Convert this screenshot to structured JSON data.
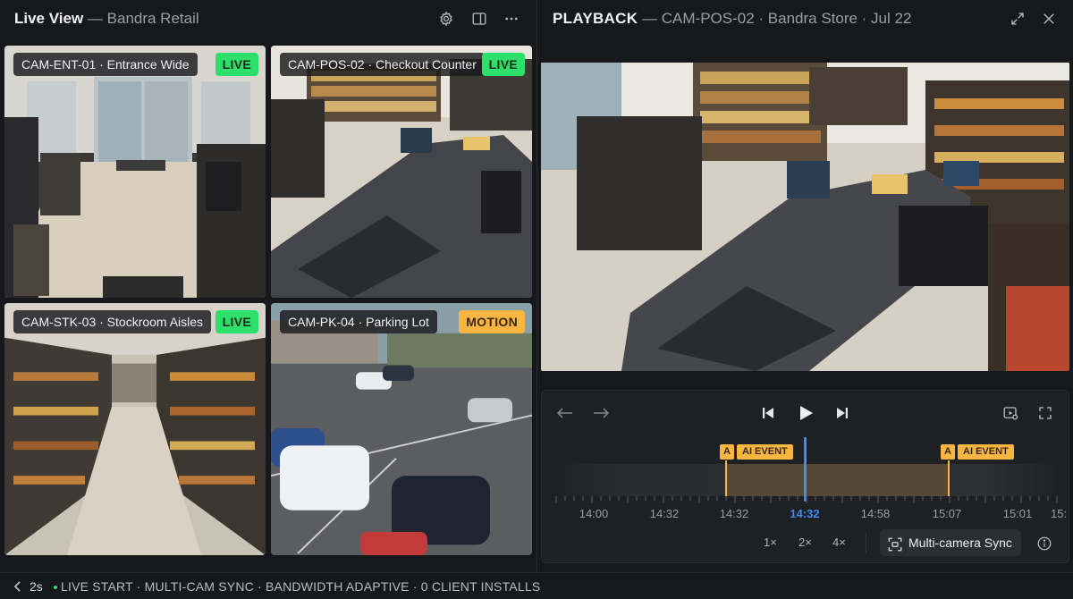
{
  "live_view": {
    "title": "Live View",
    "subtitle": "— Bandra Retail",
    "icons": [
      "gear-icon",
      "panel-layout-icon",
      "more-icon"
    ]
  },
  "tiles": [
    {
      "label": "CAM-ENT-01 · Entrance Wide",
      "badge": "LIVE",
      "badge_type": "live"
    },
    {
      "label": "CAM-POS-02 · Checkout Counter",
      "badge": "LIVE",
      "badge_type": "live"
    },
    {
      "label": "CAM-STK-03 · Stockroom Aisles",
      "badge": "LIVE",
      "badge_type": "live"
    },
    {
      "label": "CAM-PK-04 · Parking Lot",
      "badge": "MOTION",
      "badge_type": "motion"
    }
  ],
  "playback": {
    "title": "PLAYBACK",
    "subtitle": "— CAM-POS-02 · Bandra Store · Jul 22",
    "icons": [
      "expand-icon",
      "close-icon"
    ]
  },
  "controls": {
    "icons": [
      "arrow-left-icon",
      "arrow-right-icon",
      "skip-back-icon",
      "play-icon",
      "skip-forward-icon",
      "clip-icon",
      "fullscreen-icon"
    ],
    "events": [
      {
        "tag": "A",
        "label": "AI EVENT"
      },
      {
        "tag": "A",
        "label": "AI EVENT"
      }
    ],
    "ticks": [
      "14:00",
      "14:32",
      "14:32",
      "14:32",
      "14:58",
      "15:07",
      "15:01",
      "15:"
    ],
    "speeds": [
      "1×",
      "2×",
      "4×"
    ],
    "sync_label": "Multi-camera Sync",
    "info_icon": "info-icon"
  },
  "statusbar": {
    "time": "2s",
    "text": "LIVE START · MULTI-CAM SYNC · BANDWIDTH ADAPTIVE · 0 CLIENT INSTALLS"
  },
  "colors": {
    "live": "#2ee06a",
    "motion": "#f7b541",
    "playhead": "#3d8df5",
    "event": "#f7b541"
  }
}
